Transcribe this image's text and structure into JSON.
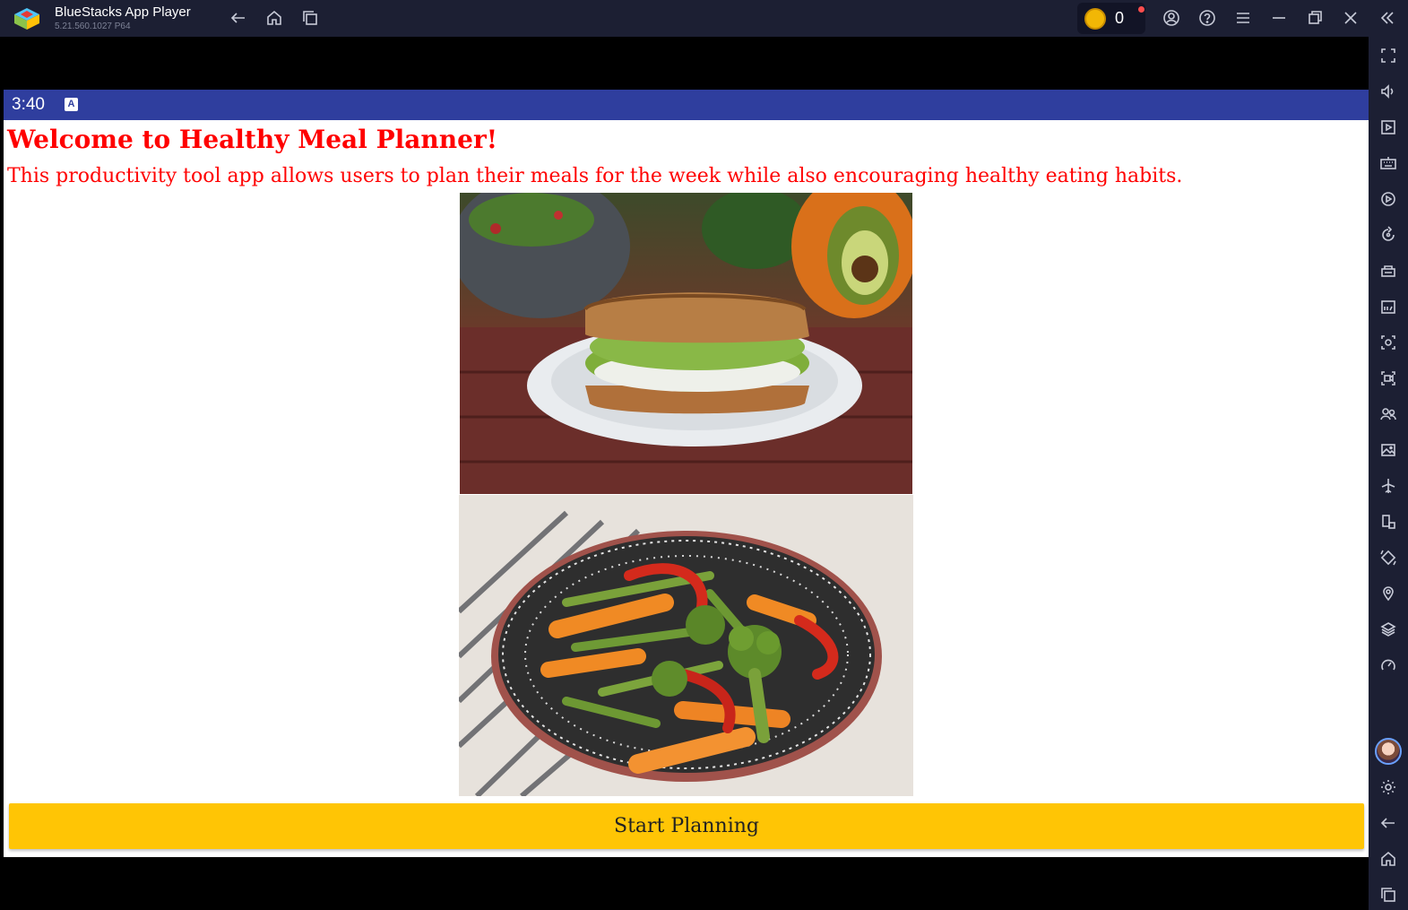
{
  "window": {
    "title": "BlueStacks App Player",
    "version": "5.21.560.1027  P64",
    "coins": "0"
  },
  "statusbar": {
    "time": "3:40",
    "notification_icon": "A"
  },
  "app": {
    "heading": "Welcome to Healthy Meal Planner!",
    "description": "This productivity tool app allows users to plan their meals for the week while also encouraging healthy eating habits.",
    "start_button": "Start Planning"
  },
  "colors": {
    "titlebar": "#1c1f33",
    "statusbar": "#2f3e9e",
    "heading_text": "#ff0000",
    "button": "#ffc505"
  },
  "icons": {
    "titlebar": [
      "back-icon",
      "home-icon",
      "multitask-icon",
      "account-icon",
      "help-icon",
      "menu-icon",
      "minimize-icon",
      "restore-icon",
      "close-icon",
      "collapse-sidebar-icon"
    ],
    "sidebar": [
      "fullscreen-icon",
      "volume-icon",
      "media-icon",
      "keyboard-icon",
      "macro-icon",
      "rotate-sync-icon",
      "performance-icon",
      "apk-install-icon",
      "screenshot-icon",
      "record-icon",
      "multi-instance-icon",
      "media-folder-icon",
      "airplane-icon",
      "devices-icon",
      "rotate-icon",
      "location-icon",
      "layers-icon",
      "speed-icon",
      "settings-icon",
      "back-icon",
      "home-icon",
      "recents-icon"
    ]
  }
}
